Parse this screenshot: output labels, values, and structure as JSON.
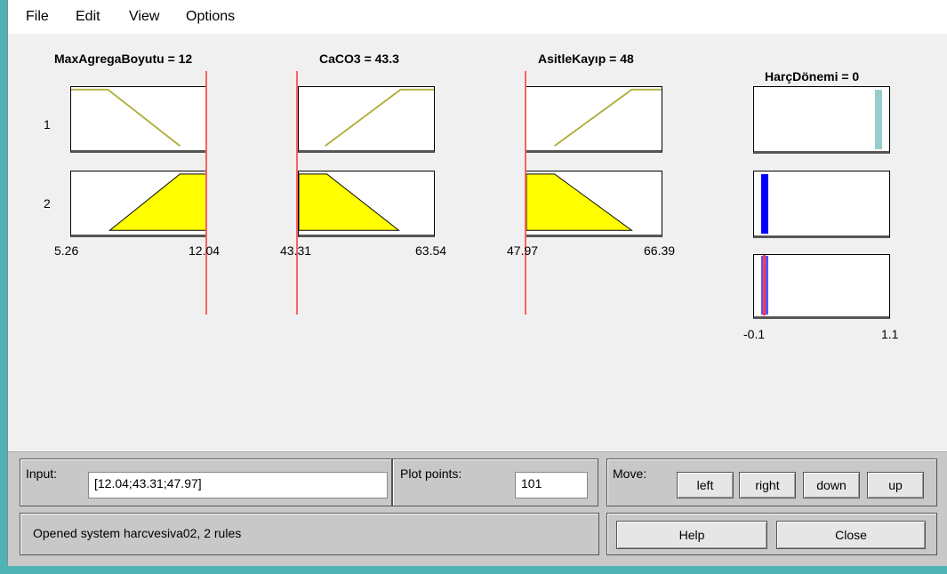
{
  "menu": [
    "File",
    "Edit",
    "View",
    "Options"
  ],
  "inputs": [
    {
      "title": "MaxAgregaBoyutu = 12",
      "range": [
        "5.26",
        "12.04"
      ],
      "rules": [
        "1",
        "2"
      ]
    },
    {
      "title": "CaCO3 = 43.3",
      "range": [
        "43.31",
        "63.54"
      ]
    },
    {
      "title": "AsitleKayıp = 48",
      "range": [
        "47.97",
        "66.39"
      ]
    }
  ],
  "output": {
    "title": "HarçDönemi = 0",
    "range": [
      "-0.1",
      "1.1"
    ]
  },
  "colors": {
    "fired_fill": "#ffff00",
    "mf_line": "#b0b040",
    "input_line": "#ff6060",
    "output_rule1": "#99cccc",
    "output_rule2": "#0000ff",
    "output_aggregate": "#5555ff"
  },
  "bottom": {
    "input_label": "Input:",
    "input_value": "[12.04;43.31;47.97]",
    "plot_points_label": "Plot points:",
    "plot_points_value": "101",
    "move_label": "Move:",
    "move_buttons": [
      "left",
      "right",
      "down",
      "up"
    ],
    "status": "Opened system harcvesiva02, 2 rules",
    "help": "Help",
    "close": "Close"
  }
}
